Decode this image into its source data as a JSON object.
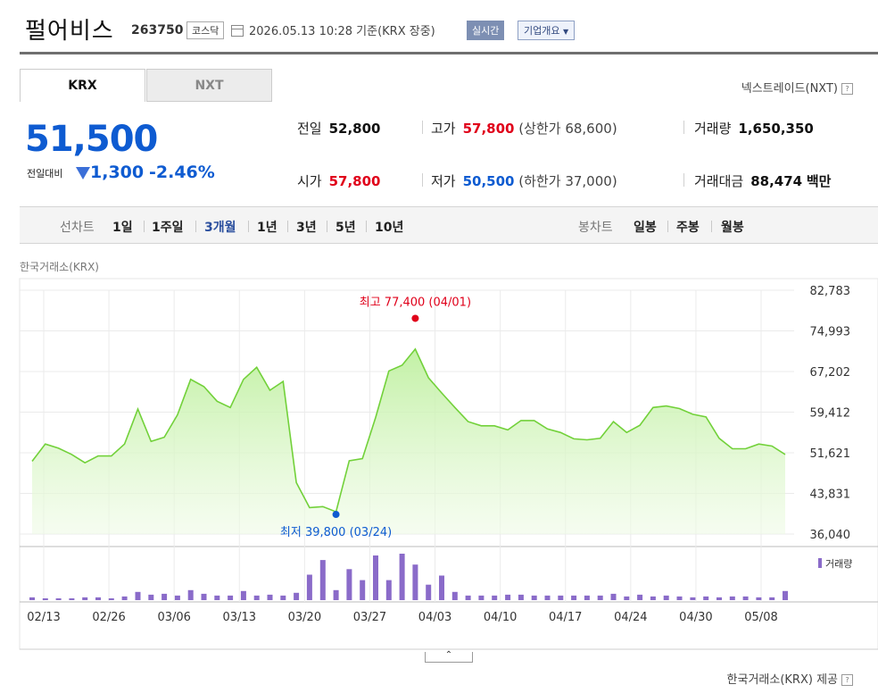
{
  "header": {
    "name": "펄어비스",
    "code": "263750",
    "market": "코스닥",
    "date_text": "2026.05.13 10:28  기준(KRX 장중)",
    "realtime_label": "실시간",
    "company_label": "기업개요"
  },
  "tabs": [
    "KRX",
    "NXT"
  ],
  "nxt_link": "넥스트레이드(NXT)",
  "quote": {
    "price": "51,500",
    "diff_label": "전일대비",
    "diff_value": "1,300",
    "diff_pct": "-2.46%",
    "prev_close_label": "전일",
    "prev_close": "52,800",
    "high_label": "고가",
    "high": "57,800",
    "upper_limit_label": "(상한가",
    "upper_limit": "68,600)",
    "volume_label": "거래량",
    "volume": "1,650,350",
    "open_label": "시가",
    "open": "57,800",
    "low_label": "저가",
    "low": "50,500",
    "lower_limit_label": "(하한가",
    "lower_limit": "37,000)",
    "amount_label": "거래대금",
    "amount": "88,474",
    "amount_unit": "백만"
  },
  "period_bar": {
    "line_label": "선차트",
    "line_periods": [
      "1일",
      "1주일",
      "3개월",
      "1년",
      "3년",
      "5년",
      "10년"
    ],
    "selected": "3개월",
    "candle_label": "봉차트",
    "candle_periods": [
      "일봉",
      "주봉",
      "월봉"
    ]
  },
  "exchange_label": "한국거래소(KRX)",
  "volume_legend": "거래량",
  "footer": "한국거래소(KRX) 제공",
  "colors": {
    "line": "#72d13a",
    "up": "#e0001a",
    "down": "#0e5bd1",
    "volume": "#8a6bc9"
  },
  "chart_data": {
    "type": "area",
    "y_ticks": [
      "82,783",
      "74,993",
      "67,202",
      "59,412",
      "51,621",
      "43,831",
      "36,040"
    ],
    "ylim": [
      36040,
      82783
    ],
    "x_ticks": [
      "02/13",
      "02/26",
      "03/06",
      "03/13",
      "03/20",
      "03/27",
      "04/03",
      "04/10",
      "04/17",
      "04/24",
      "04/30",
      "05/08"
    ],
    "max_label": "최고 77,400 (04/01)",
    "min_label": "최저 39,800 (03/24)",
    "max_value": 77400,
    "min_value": 39800,
    "series": [
      {
        "values": [
          50000,
          53300,
          52500,
          51300,
          49700,
          51000,
          51000,
          53300,
          60000,
          53800,
          54600,
          58900,
          65700,
          64300,
          61500,
          60300,
          65700,
          68000,
          63600,
          65300,
          45900,
          41100,
          41300,
          40300,
          50100,
          50500,
          58400,
          67300,
          68400,
          71500,
          66000,
          63100,
          60300,
          57600,
          56800,
          56800,
          56000,
          57800,
          57800,
          56200,
          55500,
          54300,
          54100,
          54400,
          57600,
          55500,
          56900,
          60300,
          60600,
          60100,
          59000,
          58500,
          54400,
          52400,
          52400,
          53300,
          52900,
          51300
        ]
      }
    ],
    "volume": [
      3,
      2,
      2,
      2,
      3,
      3,
      2,
      4,
      9,
      6,
      7,
      5,
      11,
      7,
      5,
      5,
      10,
      5,
      6,
      5,
      8,
      28,
      44,
      11,
      34,
      22,
      49,
      22,
      51,
      39,
      17,
      27,
      9,
      5,
      5,
      5,
      6,
      6,
      5,
      5,
      5,
      5,
      5,
      5,
      7,
      4,
      6,
      4,
      5,
      4,
      3,
      4,
      3,
      4,
      4,
      3,
      3,
      10
    ]
  }
}
